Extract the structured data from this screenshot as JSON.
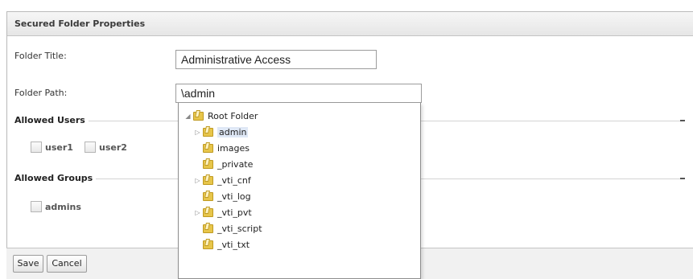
{
  "panel": {
    "title": "Secured Folder Properties"
  },
  "form": {
    "folder_title_label": "Folder Title:",
    "folder_title_value": "Administrative Access",
    "folder_path_label": "Folder Path:",
    "folder_path_value": "\\admin"
  },
  "allowed_users": {
    "legend": "Allowed Users",
    "users": [
      "user1",
      "user2"
    ]
  },
  "allowed_groups": {
    "legend": "Allowed Groups",
    "groups": [
      "admins"
    ]
  },
  "buttons": {
    "save": "Save",
    "cancel": "Cancel"
  },
  "tree": {
    "root": "Root Folder",
    "items": [
      {
        "label": "admin",
        "expandable": true,
        "selected": true
      },
      {
        "label": "images",
        "expandable": false,
        "selected": false
      },
      {
        "label": "_private",
        "expandable": false,
        "selected": false
      },
      {
        "label": "_vti_cnf",
        "expandable": true,
        "selected": false
      },
      {
        "label": "_vti_log",
        "expandable": false,
        "selected": false
      },
      {
        "label": "_vti_pvt",
        "expandable": true,
        "selected": false
      },
      {
        "label": "_vti_script",
        "expandable": false,
        "selected": false
      },
      {
        "label": "_vti_txt",
        "expandable": false,
        "selected": false
      }
    ]
  },
  "icons": {
    "folder": "folder-icon",
    "expand": "expand-arrow-icon",
    "collapse": "collapse-arrow-icon"
  },
  "colors": {
    "folder": "#e7c54a",
    "selection": "#dfe8f6",
    "header_bg": "#e6e6e6"
  }
}
